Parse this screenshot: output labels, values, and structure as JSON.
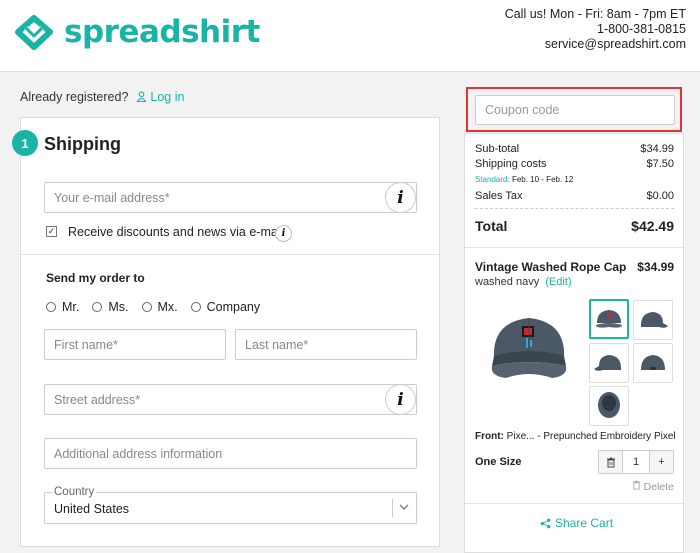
{
  "header": {
    "logo_text": "spreadshirt",
    "contact_hours": "Call us! Mon - Fri: 8am - 7pm ET",
    "contact_phone": "1-800-381-0815",
    "contact_email": "service@spreadshirt.com"
  },
  "login": {
    "prompt": "Already registered?",
    "link": "Log in"
  },
  "shipping": {
    "step": "1",
    "title": "Shipping",
    "email_placeholder": "Your e-mail address*",
    "info_glyph": "i",
    "newsletter_label": "Receive discounts and news via e-mail",
    "newsletter_checked": true,
    "send_to_title": "Send my order to",
    "salutations": [
      "Mr.",
      "Ms.",
      "Mx.",
      "Company"
    ],
    "first_name_placeholder": "First name*",
    "last_name_placeholder": "Last name*",
    "street_placeholder": "Street address*",
    "additional_placeholder": "Additional address information",
    "country_label": "Country",
    "country_value": "United States"
  },
  "summary": {
    "coupon_placeholder": "Coupon code",
    "subtotal_label": "Sub-total",
    "subtotal_value": "$34.99",
    "shipping_label": "Shipping costs",
    "shipping_value": "$7.50",
    "shipping_note_prefix": "Standard:",
    "shipping_note_dates": "Feb. 10 - Feb. 12",
    "tax_label": "Sales Tax",
    "tax_value": "$0.00",
    "total_label": "Total",
    "total_value": "$42.49"
  },
  "product": {
    "name": "Vintage Washed Rope Cap",
    "price": "$34.99",
    "color": "washed navy",
    "edit_label": "(Edit)",
    "front_label": "Front:",
    "front_text": "Pixe... - Prepunched Embroidery Pixel",
    "size": "One Size",
    "quantity": "1",
    "minus_icon": "trash-icon",
    "plus_label": "+",
    "delete_label": "Delete",
    "share_label": "Share Cart"
  },
  "colors": {
    "brand": "#1ab3a6",
    "highlight": "#e53333"
  }
}
